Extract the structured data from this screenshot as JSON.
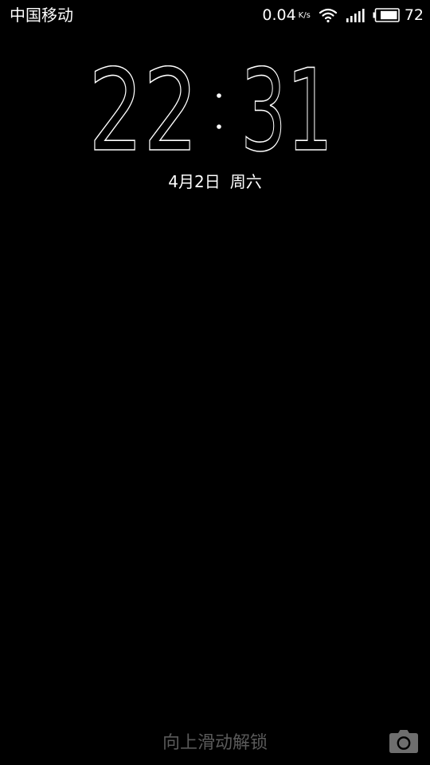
{
  "status_bar": {
    "carrier": "中国移动",
    "net_speed": "0.04",
    "net_speed_unit": "K/s",
    "wifi_icon": "wifi-icon",
    "signal_icon": "signal-icon",
    "battery_icon": "battery-icon",
    "battery_level": "72"
  },
  "lock_screen": {
    "hour": "22",
    "separator": ":",
    "minute": "31",
    "date": "4月2日",
    "weekday": "周六",
    "unlock_hint": "向上滑动解锁",
    "camera_icon": "camera-icon"
  },
  "colors": {
    "background": "#000000",
    "text": "#ffffff",
    "hint": "#5a5a5a",
    "camera": "#6e6e6e"
  }
}
